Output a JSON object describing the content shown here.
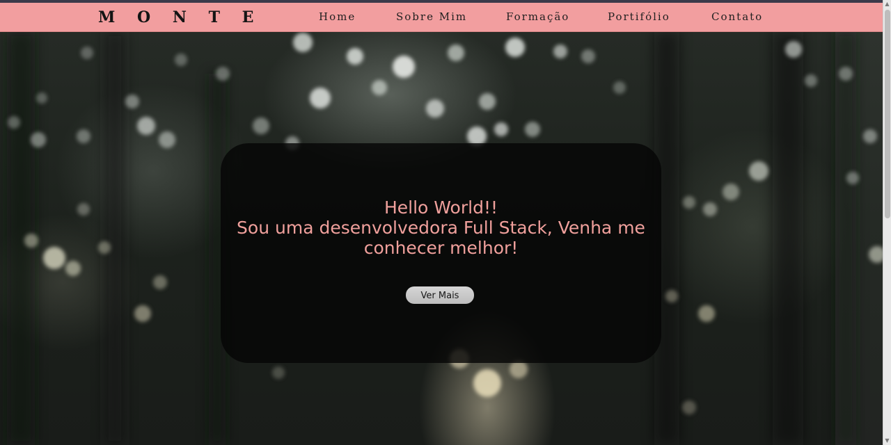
{
  "header": {
    "brand": "M O N T E",
    "nav": [
      {
        "label": "Home"
      },
      {
        "label": "Sobre Mim"
      },
      {
        "label": "Formação"
      },
      {
        "label": "Portifólio"
      },
      {
        "label": "Contato"
      }
    ]
  },
  "hero": {
    "lines": [
      "Hello World!!",
      "Sou uma desenvolvedora Full Stack, Venha me",
      "conhecer melhor!"
    ],
    "button_label": "Ver Mais",
    "background": "blurred-forest-photo"
  },
  "colors": {
    "navbar": "#f29e9f",
    "accent_text": "#f0a09c",
    "card": "#050505",
    "button": "#cfcfcf"
  },
  "icons": {
    "scroll_up": "triangle-up",
    "scroll_down": "triangle-down"
  }
}
